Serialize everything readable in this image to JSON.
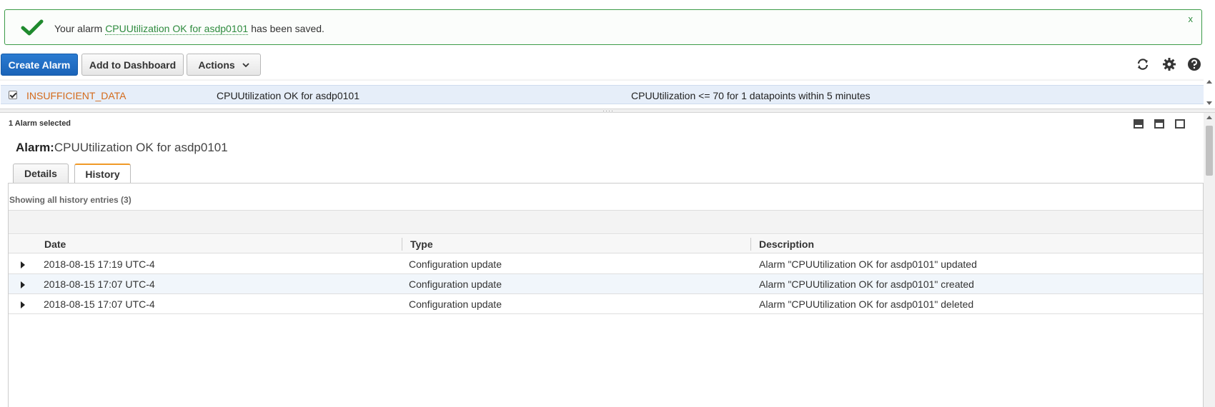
{
  "banner": {
    "prefix": "Your alarm",
    "alarm_link": "CPUUtilization OK for asdp0101",
    "suffix": "has been saved.",
    "close": "x",
    "check_icon": "checkmark-icon",
    "accent": "#2e8b3e"
  },
  "toolbar": {
    "create_label": "Create Alarm",
    "dashboard_label": "Add to Dashboard",
    "actions_label": "Actions",
    "icons": [
      "refresh-icon",
      "gear-icon",
      "help-icon"
    ]
  },
  "alarms_table": {
    "selected_row": {
      "state": "INSUFFICIENT_DATA",
      "name": "CPUUtilization OK for asdp0101",
      "condition": "CPUUtilization <= 70 for 1 datapoints within 5 minutes",
      "checked": true,
      "state_color": "#d46a1a"
    }
  },
  "details": {
    "selected_count": "1 Alarm selected",
    "alarm_label": "Alarm:",
    "alarm_name": "CPUUtilization OK for asdp0101",
    "tabs": {
      "details": "Details",
      "history": "History"
    },
    "showing_text": "Showing all history entries (3)",
    "history": {
      "columns": {
        "date": "Date",
        "type": "Type",
        "description": "Description"
      },
      "rows": [
        {
          "date": "2018-08-15 17:19 UTC-4",
          "type": "Configuration update",
          "description": "Alarm \"CPUUtilization OK for asdp0101\" updated"
        },
        {
          "date": "2018-08-15 17:07 UTC-4",
          "type": "Configuration update",
          "description": "Alarm \"CPUUtilization OK for asdp0101\" created"
        },
        {
          "date": "2018-08-15 17:07 UTC-4",
          "type": "Configuration update",
          "description": "Alarm \"CPUUtilization OK for asdp0101\" deleted"
        }
      ]
    }
  }
}
